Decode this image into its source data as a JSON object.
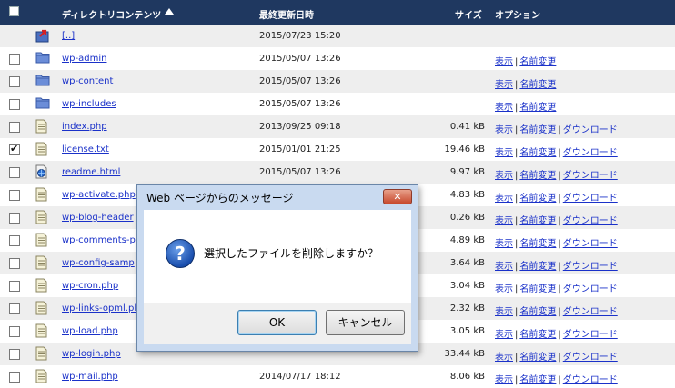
{
  "header": {
    "col_name": "ディレクトリコンテンツ",
    "col_date": "最終更新日時",
    "col_size": "サイズ",
    "col_options": "オプション"
  },
  "rows": [
    {
      "name": "[..]",
      "date": "2015/07/23 15:20",
      "size": "",
      "checked": false,
      "icon": "parent-dir-icon",
      "ops": []
    },
    {
      "name": "wp-admin",
      "date": "2015/05/07 13:26",
      "size": "",
      "checked": false,
      "icon": "folder-icon",
      "ops": [
        "表示",
        "名前変更"
      ]
    },
    {
      "name": "wp-content",
      "date": "2015/05/07 13:26",
      "size": "",
      "checked": false,
      "icon": "folder-icon",
      "ops": [
        "表示",
        "名前変更"
      ]
    },
    {
      "name": "wp-includes",
      "date": "2015/05/07 13:26",
      "size": "",
      "checked": false,
      "icon": "folder-icon",
      "ops": [
        "表示",
        "名前変更"
      ]
    },
    {
      "name": "index.php",
      "date": "2013/09/25 09:18",
      "size": "0.41  kB",
      "checked": false,
      "icon": "file-icon",
      "ops": [
        "表示",
        "名前変更",
        "ダウンロード"
      ]
    },
    {
      "name": "license.txt",
      "date": "2015/01/01 21:25",
      "size": "19.46  kB",
      "checked": true,
      "icon": "file-icon",
      "ops": [
        "表示",
        "名前変更",
        "ダウンロード"
      ]
    },
    {
      "name": "readme.html",
      "date": "2015/05/07 13:26",
      "size": "9.97  kB",
      "checked": false,
      "icon": "html-file-icon",
      "ops": [
        "表示",
        "名前変更",
        "ダウンロード"
      ]
    },
    {
      "name": "wp-activate.php",
      "date": "",
      "size": "4.83  kB",
      "checked": false,
      "icon": "file-icon",
      "ops": [
        "表示",
        "名前変更",
        "ダウンロード"
      ]
    },
    {
      "name": "wp-blog-header",
      "date": "",
      "size": "0.26  kB",
      "checked": false,
      "icon": "file-icon",
      "ops": [
        "表示",
        "名前変更",
        "ダウンロード"
      ]
    },
    {
      "name": "wp-comments-p",
      "date": "",
      "size": "4.89  kB",
      "checked": false,
      "icon": "file-icon",
      "ops": [
        "表示",
        "名前変更",
        "ダウンロード"
      ]
    },
    {
      "name": "wp-config-samp",
      "date": "",
      "size": "3.64  kB",
      "checked": false,
      "icon": "file-icon",
      "ops": [
        "表示",
        "名前変更",
        "ダウンロード"
      ]
    },
    {
      "name": "wp-cron.php",
      "date": "",
      "size": "3.04  kB",
      "checked": false,
      "icon": "file-icon",
      "ops": [
        "表示",
        "名前変更",
        "ダウンロード"
      ]
    },
    {
      "name": "wp-links-opml.pl",
      "date": "",
      "size": "2.32  kB",
      "checked": false,
      "icon": "file-icon",
      "ops": [
        "表示",
        "名前変更",
        "ダウンロード"
      ]
    },
    {
      "name": "wp-load.php",
      "date": "",
      "size": "3.05  kB",
      "checked": false,
      "icon": "file-icon",
      "ops": [
        "表示",
        "名前変更",
        "ダウンロード"
      ]
    },
    {
      "name": "wp-login.php",
      "date": "",
      "size": "33.44  kB",
      "checked": false,
      "icon": "file-icon",
      "ops": [
        "表示",
        "名前変更",
        "ダウンロード"
      ]
    },
    {
      "name": "wp-mail.php",
      "date": "2014/07/17 18:12",
      "size": "8.06  kB",
      "checked": false,
      "icon": "file-icon",
      "ops": [
        "表示",
        "名前変更",
        "ダウンロード"
      ]
    }
  ],
  "dialog": {
    "title": "Web ページからのメッセージ",
    "close_label": "✕",
    "message": "選択したファイルを削除しますか？",
    "ok_label": "OK",
    "cancel_label": "キャンセル",
    "icon": "question-icon"
  }
}
